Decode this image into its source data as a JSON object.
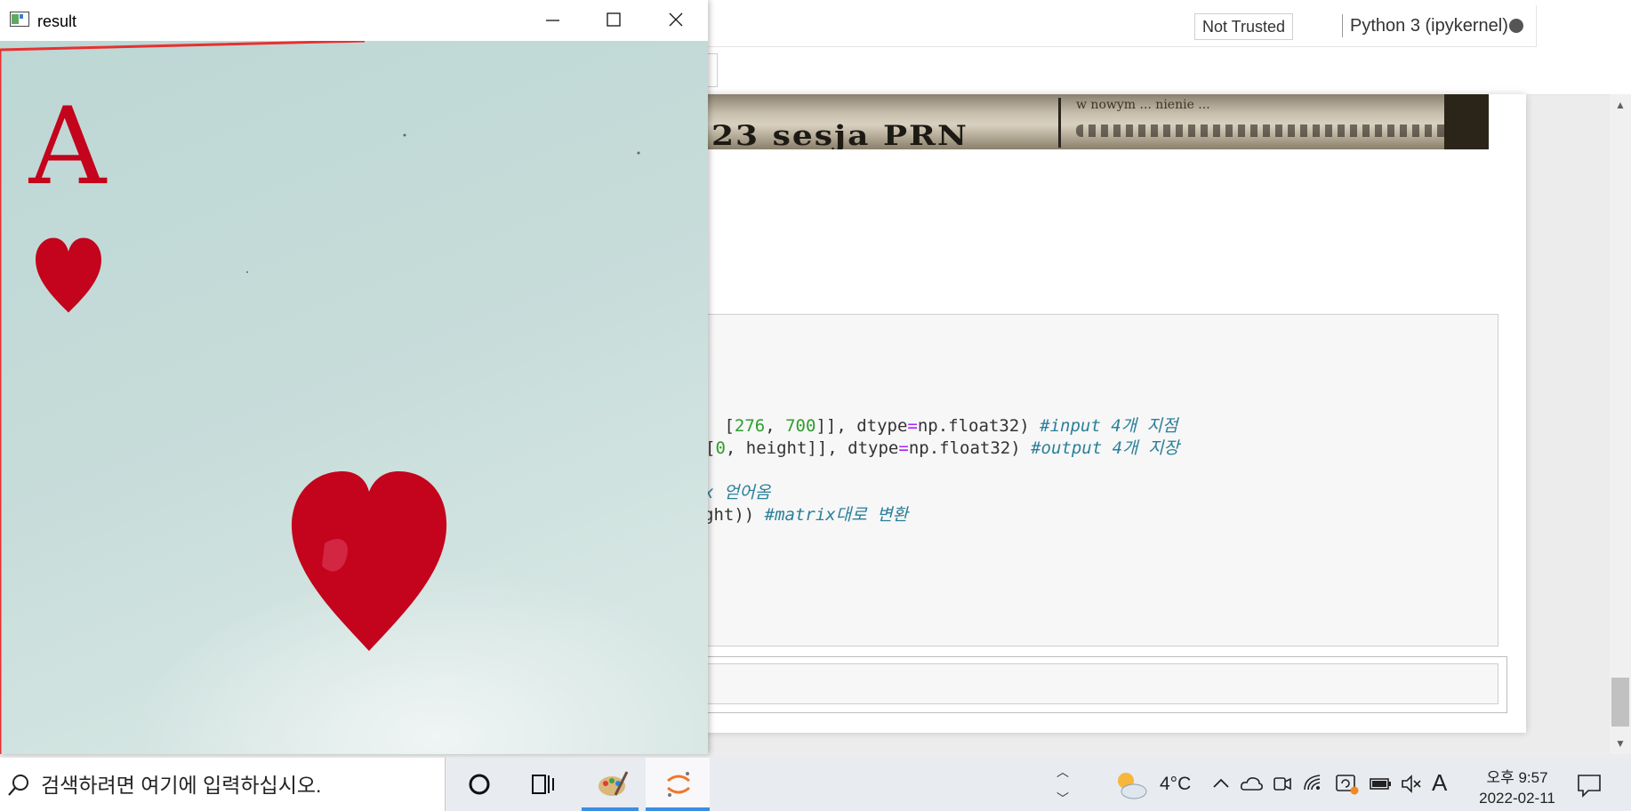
{
  "notebook": {
    "trust_status": "Not Trusted",
    "kernel_name": "Python 3 (ipykernel)",
    "code_lines": [
      {
        "pre": " [",
        "n1": "276",
        "mid1": ", ",
        "n2": "700",
        "mid2": "]], dtype",
        "op": "=",
        "tail": "np.float32) ",
        "comment": "#input 4개 지점"
      },
      {
        "pre": "[",
        "n1": "0",
        "mid1": ", height]], dtype",
        "op": "=",
        "tail": "np.float32) ",
        "comment": "#output 4개 지장"
      },
      {
        "comment": "x 얻어옴"
      },
      {
        "pre": "ght)) ",
        "comment": "#matrix대로 변환"
      }
    ]
  },
  "result_window": {
    "title": "result",
    "minimize_label": "minimize",
    "maximize_label": "maximize",
    "close_label": "close",
    "image": {
      "card_rank": "A",
      "card_suit": "heart",
      "suit_color": "#c4031c",
      "background_color": "#c5dcd9"
    }
  },
  "taskbar": {
    "search_placeholder": "검색하려면 여기에 입력하십시오.",
    "temperature": "4°C",
    "ime_indicator": "A",
    "clock_time": "오후 9:57",
    "clock_date": "2022-02-11",
    "pinned_apps": [
      "cortana-icon",
      "task-view-icon",
      "paint-icon",
      "jupyter-icon"
    ]
  }
}
